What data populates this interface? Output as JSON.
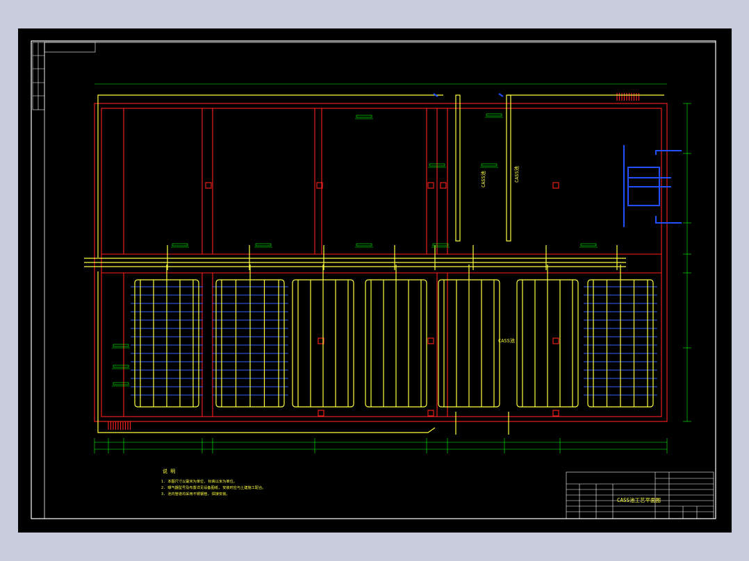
{
  "drawing": {
    "title_block_name": "CASS池工艺平面图",
    "tank_labels": [
      "CASS池",
      "CASS池",
      "CASS池"
    ],
    "notes_heading": "说 明",
    "notes": [
      "1. 本图尺寸以毫米为单位, 标高以米为单位。",
      "2. 曝气器型号及布置详见设备图纸, 安装时应与土建施工配合。",
      "3. 池内管道均采用不锈钢管, 焊接安装。"
    ]
  },
  "colors": {
    "background": "#000000",
    "frame": "#ffffff",
    "walls": "#ff2020",
    "pipes": "#ffff40",
    "pipes_dark": "#c8c800",
    "diffusers": "#3060ff",
    "dimensions": "#00ff00",
    "valves": "#2050ff"
  }
}
